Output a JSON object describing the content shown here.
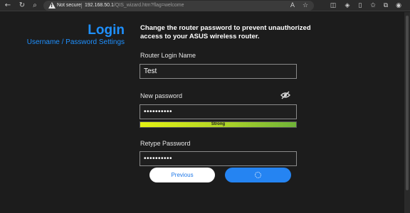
{
  "browser": {
    "security_label": "Not secure",
    "url_host": "192.168.50.1",
    "url_path": "/QIS_wizard.htm?flag=welcome"
  },
  "sidebar": {
    "title": "Login",
    "subtitle": "Username / Password Settings"
  },
  "main": {
    "heading": "Change the router password to prevent unauthorized access to your ASUS wireless router.",
    "login_name_label": "Router Login Name",
    "login_name_value": "Test",
    "new_password_label": "New password",
    "new_password_value": "••••••••••",
    "strength": {
      "label": "Strong",
      "level": 1.0
    },
    "retype_label": "Retype Password",
    "retype_value": "••••••••••"
  },
  "buttons": {
    "previous": "Previous"
  },
  "colors": {
    "accent": "#1e90ff",
    "next_button": "#2584f2"
  }
}
